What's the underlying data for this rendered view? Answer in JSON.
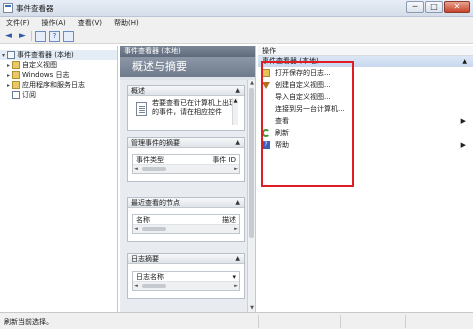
{
  "window": {
    "title": "事件查看器",
    "minimize": "─",
    "maximize": "□",
    "close": "✕"
  },
  "menu": [
    "文件(F)",
    "操作(A)",
    "查看(V)",
    "帮助(H)"
  ],
  "toolbar": {
    "back": "◄",
    "forward": "►"
  },
  "tree": {
    "root": "事件查看器 (本地)",
    "items": [
      "自定义视图",
      "Windows 日志",
      "应用程序和服务日志",
      "订阅"
    ]
  },
  "center": {
    "header": "事件查看器 (本地)",
    "banner": "概述与摘要",
    "sections": {
      "overview": {
        "title": "概述",
        "text": "若要查看已在计算机上出现的事件，请在相应控件"
      },
      "summary": {
        "title": "管理事件的摘要",
        "col1": "事件类型",
        "col2": "事件 ID"
      },
      "recent": {
        "title": "最近查看的节点",
        "col1": "名称",
        "col2": "描述"
      },
      "logs": {
        "title": "日志摘要",
        "col1": "日志名称"
      }
    }
  },
  "actions": {
    "header": "操作",
    "group": "事件查看器 (本地)",
    "items": [
      {
        "label": "打开保存的日志...",
        "icon": "folder-icon"
      },
      {
        "label": "创建自定义视图...",
        "icon": "filter-icon"
      },
      {
        "label": "导入自定义视图...",
        "icon": "none"
      },
      {
        "label": "连接到另一台计算机...",
        "icon": "none"
      },
      {
        "label": "查看",
        "icon": "none",
        "submenu": true
      },
      {
        "label": "刷新",
        "icon": "refresh-icon"
      },
      {
        "label": "帮助",
        "icon": "help-icon",
        "submenu": true
      }
    ]
  },
  "status": {
    "text": "刷新当前选择。"
  },
  "colors": {
    "highlight": "#e01c25",
    "accent": "#3b73b9"
  }
}
